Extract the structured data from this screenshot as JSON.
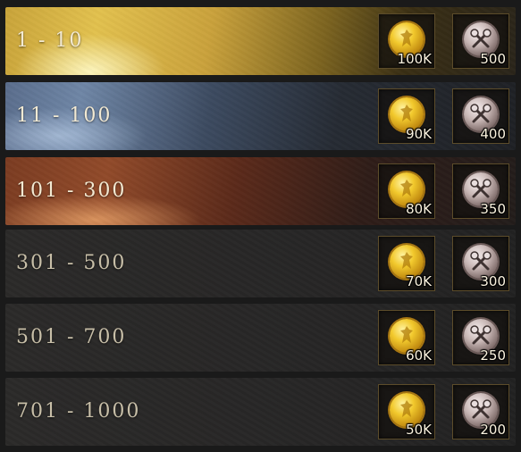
{
  "rewards": [
    {
      "rank": "1 - 10",
      "gold": "100K",
      "silver": "500"
    },
    {
      "rank": "11 - 100",
      "gold": "90K",
      "silver": "400"
    },
    {
      "rank": "101 - 300",
      "gold": "80K",
      "silver": "350"
    },
    {
      "rank": "301 - 500",
      "gold": "70K",
      "silver": "300"
    },
    {
      "rank": "501 - 700",
      "gold": "60K",
      "silver": "250"
    },
    {
      "rank": "701 - 1000",
      "gold": "50K",
      "silver": "200"
    }
  ],
  "icons": {
    "gold": "gold-coin-icon",
    "silver": "crossed-axes-medal-icon"
  },
  "colors": {
    "gold_tier": "#d8b444",
    "silver_tier": "#6f86a6",
    "bronze_tier": "#914a2a",
    "base_tier": "#2a2928"
  }
}
